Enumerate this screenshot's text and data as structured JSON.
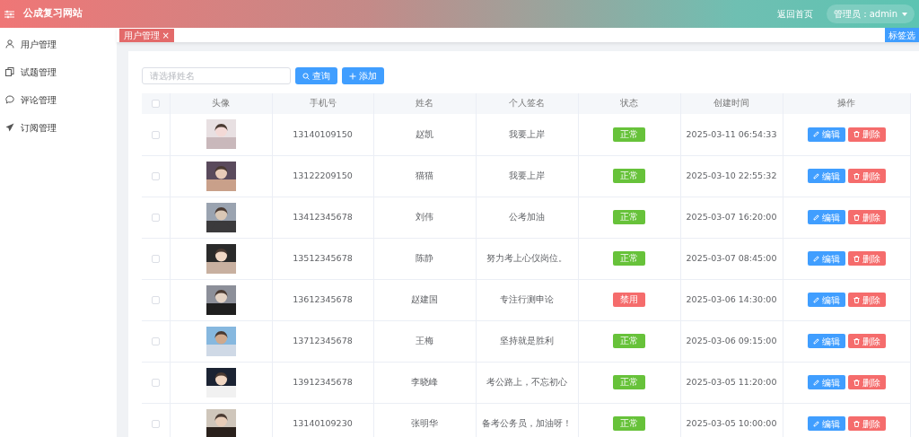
{
  "header": {
    "title": "公成复习网站",
    "home_link": "返回首页",
    "user_menu": "管理员：admin"
  },
  "sidebar": {
    "items": [
      {
        "label": "用户管理"
      },
      {
        "label": "试题管理"
      },
      {
        "label": "评论管理"
      },
      {
        "label": "订阅管理"
      }
    ]
  },
  "tabs": [
    {
      "label": "用户管理",
      "close": "×",
      "selected": true
    }
  ],
  "tab_options": "标签选",
  "search": {
    "placeholder": "请选择姓名"
  },
  "toolbar": [
    {
      "label": "查询"
    },
    {
      "label": "添加"
    }
  ],
  "table": {
    "select_all_checked": false,
    "columns": [
      "头像",
      "手机号",
      "姓名",
      "个人签名",
      "状态",
      "创建时间",
      "操作"
    ],
    "rows": [
      {
        "checked": false,
        "phone": "13140109150",
        "name": "赵凯",
        "signature": "我要上岸",
        "status": {
          "label": "正常",
          "kind": "ok"
        },
        "created": "2025-03-11 06:54:33",
        "actions": [
          "编辑",
          "删除"
        ]
      },
      {
        "checked": false,
        "phone": "13122209150",
        "name": "猫猫",
        "signature": "我要上岸",
        "status": {
          "label": "正常",
          "kind": "ok"
        },
        "created": "2025-03-10 22:55:32",
        "actions": [
          "编辑",
          "删除"
        ]
      },
      {
        "checked": false,
        "phone": "13412345678",
        "name": "刘伟",
        "signature": "公考加油",
        "status": {
          "label": "正常",
          "kind": "ok"
        },
        "created": "2025-03-07 16:20:00",
        "actions": [
          "编辑",
          "删除"
        ]
      },
      {
        "checked": false,
        "phone": "13512345678",
        "name": "陈静",
        "signature": "努力考上心仪岗位。",
        "status": {
          "label": "正常",
          "kind": "ok"
        },
        "created": "2025-03-07 08:45:00",
        "actions": [
          "编辑",
          "删除"
        ]
      },
      {
        "checked": false,
        "phone": "13612345678",
        "name": "赵建国",
        "signature": "专注行测申论",
        "status": {
          "label": "禁用",
          "kind": "disabled"
        },
        "created": "2025-03-06 14:30:00",
        "actions": [
          "编辑",
          "删除"
        ]
      },
      {
        "checked": false,
        "phone": "13712345678",
        "name": "王梅",
        "signature": "坚持就是胜利",
        "status": {
          "label": "正常",
          "kind": "ok"
        },
        "created": "2025-03-06 09:15:00",
        "actions": [
          "编辑",
          "删除"
        ]
      },
      {
        "checked": false,
        "phone": "13912345678",
        "name": "李晓峰",
        "signature": "考公路上，不忘初心",
        "status": {
          "label": "正常",
          "kind": "ok"
        },
        "created": "2025-03-05 11:20:00",
        "actions": [
          "编辑",
          "删除"
        ]
      },
      {
        "checked": false,
        "phone": "13140109230",
        "name": "张明华",
        "signature": "备考公务员，加油呀！",
        "status": {
          "label": "正常",
          "kind": "ok"
        },
        "created": "2025-03-05 10:00:00",
        "actions": [
          "编辑",
          "删除"
        ]
      }
    ]
  }
}
